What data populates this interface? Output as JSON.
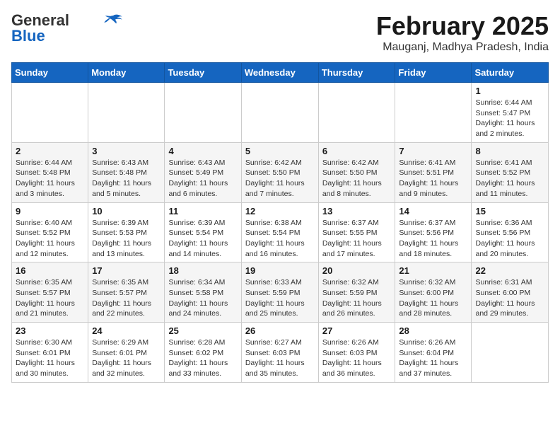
{
  "header": {
    "logo_general": "General",
    "logo_blue": "Blue",
    "title": "February 2025",
    "location": "Mauganj, Madhya Pradesh, India"
  },
  "weekdays": [
    "Sunday",
    "Monday",
    "Tuesday",
    "Wednesday",
    "Thursday",
    "Friday",
    "Saturday"
  ],
  "weeks": [
    [
      {
        "day": "",
        "info": ""
      },
      {
        "day": "",
        "info": ""
      },
      {
        "day": "",
        "info": ""
      },
      {
        "day": "",
        "info": ""
      },
      {
        "day": "",
        "info": ""
      },
      {
        "day": "",
        "info": ""
      },
      {
        "day": "1",
        "info": "Sunrise: 6:44 AM\nSunset: 5:47 PM\nDaylight: 11 hours and 2 minutes."
      }
    ],
    [
      {
        "day": "2",
        "info": "Sunrise: 6:44 AM\nSunset: 5:48 PM\nDaylight: 11 hours and 3 minutes."
      },
      {
        "day": "3",
        "info": "Sunrise: 6:43 AM\nSunset: 5:48 PM\nDaylight: 11 hours and 5 minutes."
      },
      {
        "day": "4",
        "info": "Sunrise: 6:43 AM\nSunset: 5:49 PM\nDaylight: 11 hours and 6 minutes."
      },
      {
        "day": "5",
        "info": "Sunrise: 6:42 AM\nSunset: 5:50 PM\nDaylight: 11 hours and 7 minutes."
      },
      {
        "day": "6",
        "info": "Sunrise: 6:42 AM\nSunset: 5:50 PM\nDaylight: 11 hours and 8 minutes."
      },
      {
        "day": "7",
        "info": "Sunrise: 6:41 AM\nSunset: 5:51 PM\nDaylight: 11 hours and 9 minutes."
      },
      {
        "day": "8",
        "info": "Sunrise: 6:41 AM\nSunset: 5:52 PM\nDaylight: 11 hours and 11 minutes."
      }
    ],
    [
      {
        "day": "9",
        "info": "Sunrise: 6:40 AM\nSunset: 5:52 PM\nDaylight: 11 hours and 12 minutes."
      },
      {
        "day": "10",
        "info": "Sunrise: 6:39 AM\nSunset: 5:53 PM\nDaylight: 11 hours and 13 minutes."
      },
      {
        "day": "11",
        "info": "Sunrise: 6:39 AM\nSunset: 5:54 PM\nDaylight: 11 hours and 14 minutes."
      },
      {
        "day": "12",
        "info": "Sunrise: 6:38 AM\nSunset: 5:54 PM\nDaylight: 11 hours and 16 minutes."
      },
      {
        "day": "13",
        "info": "Sunrise: 6:37 AM\nSunset: 5:55 PM\nDaylight: 11 hours and 17 minutes."
      },
      {
        "day": "14",
        "info": "Sunrise: 6:37 AM\nSunset: 5:56 PM\nDaylight: 11 hours and 18 minutes."
      },
      {
        "day": "15",
        "info": "Sunrise: 6:36 AM\nSunset: 5:56 PM\nDaylight: 11 hours and 20 minutes."
      }
    ],
    [
      {
        "day": "16",
        "info": "Sunrise: 6:35 AM\nSunset: 5:57 PM\nDaylight: 11 hours and 21 minutes."
      },
      {
        "day": "17",
        "info": "Sunrise: 6:35 AM\nSunset: 5:57 PM\nDaylight: 11 hours and 22 minutes."
      },
      {
        "day": "18",
        "info": "Sunrise: 6:34 AM\nSunset: 5:58 PM\nDaylight: 11 hours and 24 minutes."
      },
      {
        "day": "19",
        "info": "Sunrise: 6:33 AM\nSunset: 5:59 PM\nDaylight: 11 hours and 25 minutes."
      },
      {
        "day": "20",
        "info": "Sunrise: 6:32 AM\nSunset: 5:59 PM\nDaylight: 11 hours and 26 minutes."
      },
      {
        "day": "21",
        "info": "Sunrise: 6:32 AM\nSunset: 6:00 PM\nDaylight: 11 hours and 28 minutes."
      },
      {
        "day": "22",
        "info": "Sunrise: 6:31 AM\nSunset: 6:00 PM\nDaylight: 11 hours and 29 minutes."
      }
    ],
    [
      {
        "day": "23",
        "info": "Sunrise: 6:30 AM\nSunset: 6:01 PM\nDaylight: 11 hours and 30 minutes."
      },
      {
        "day": "24",
        "info": "Sunrise: 6:29 AM\nSunset: 6:01 PM\nDaylight: 11 hours and 32 minutes."
      },
      {
        "day": "25",
        "info": "Sunrise: 6:28 AM\nSunset: 6:02 PM\nDaylight: 11 hours and 33 minutes."
      },
      {
        "day": "26",
        "info": "Sunrise: 6:27 AM\nSunset: 6:03 PM\nDaylight: 11 hours and 35 minutes."
      },
      {
        "day": "27",
        "info": "Sunrise: 6:26 AM\nSunset: 6:03 PM\nDaylight: 11 hours and 36 minutes."
      },
      {
        "day": "28",
        "info": "Sunrise: 6:26 AM\nSunset: 6:04 PM\nDaylight: 11 hours and 37 minutes."
      },
      {
        "day": "",
        "info": ""
      }
    ]
  ]
}
